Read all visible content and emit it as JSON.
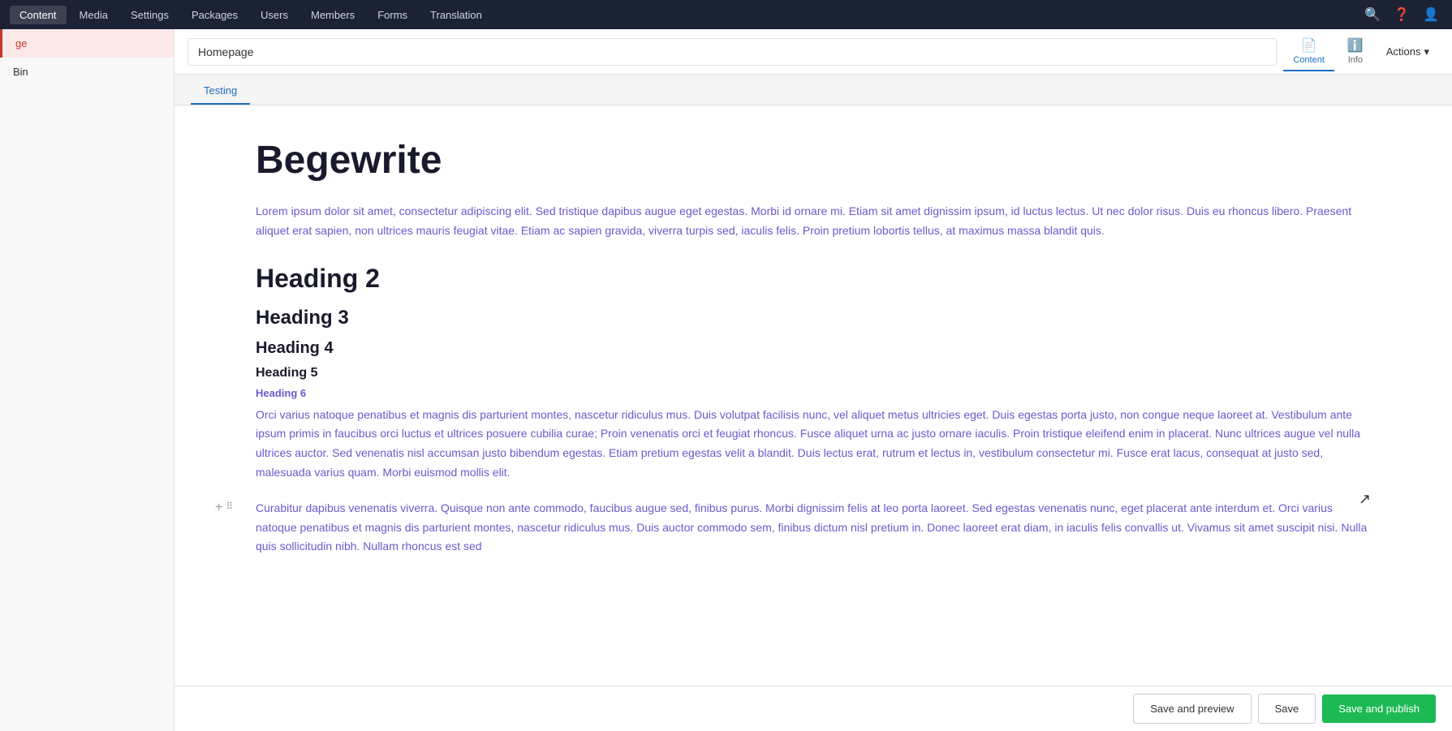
{
  "nav": {
    "items": [
      {
        "label": "Content",
        "active": true
      },
      {
        "label": "Media"
      },
      {
        "label": "Settings"
      },
      {
        "label": "Packages"
      },
      {
        "label": "Users"
      },
      {
        "label": "Members"
      },
      {
        "label": "Forms"
      },
      {
        "label": "Translation"
      }
    ]
  },
  "sidebar": {
    "page_label": "ge",
    "bin_label": "Bin"
  },
  "header": {
    "page_title": "Homepage",
    "content_tab": "Content",
    "info_tab": "Info",
    "actions_label": "Actions"
  },
  "editor_tab": {
    "label": "Testing"
  },
  "content": {
    "title": "Begewrite",
    "intro": "Lorem ipsum dolor sit amet, consectetur adipiscing elit. Sed tristique dapibus augue eget egestas. Morbi id ornare mi. Etiam sit amet dignissim ipsum, id luctus lectus. Ut nec dolor risus. Duis eu rhoncus libero. Praesent aliquet erat sapien, non ultrices mauris feugiat vitae. Etiam ac sapien gravida, viverra turpis sed, iaculis felis. Proin pretium lobortis tellus, at maximus massa blandit quis.",
    "h2": "Heading 2",
    "h3": "Heading 3",
    "h4": "Heading 4",
    "h5": "Heading 5",
    "h6": "Heading 6",
    "para1": "Orci varius natoque penatibus et magnis dis parturient montes, nascetur ridiculus mus. Duis volutpat facilisis nunc, vel aliquet metus ultricies eget. Duis egestas porta justo, non congue neque laoreet at. Vestibulum ante ipsum primis in faucibus orci luctus et ultrices posuere cubilia curae; Proin venenatis orci et feugiat rhoncus. Fusce aliquet urna ac justo ornare iaculis. Proin tristique eleifend enim in placerat. Nunc ultrices augue vel nulla ultrices auctor. Sed venenatis nisl accumsan justo bibendum egestas. Etiam pretium egestas velit a blandit. Duis lectus erat, rutrum et lectus in, vestibulum consectetur mi. Fusce erat lacus, consequat at justo sed, malesuada varius quam. Morbi euismod mollis elit.",
    "para2": "Curabitur dapibus venenatis viverra. Quisque non ante commodo, faucibus augue sed, finibus purus. Morbi dignissim felis at leo porta laoreet. Sed egestas venenatis nunc, eget placerat ante interdum et. Orci varius natoque penatibus et magnis dis parturient montes, nascetur ridiculus mus. Duis auctor commodo sem, finibus dictum nisl pretium in. Donec laoreet erat diam, in iaculis felis convallis ut. Vivamus sit amet suscipit nisi. Nulla quis sollicitudin nibh. Nullam rhoncus est sed"
  },
  "buttons": {
    "save_preview": "Save and preview",
    "save": "Save",
    "save_publish": "Save and publish"
  },
  "colors": {
    "active_blue": "#1b6ec2",
    "publish_green": "#1db954",
    "heading_color": "#1a1a2e",
    "link_color": "#6a5acd",
    "nav_bg": "#1a2234"
  }
}
